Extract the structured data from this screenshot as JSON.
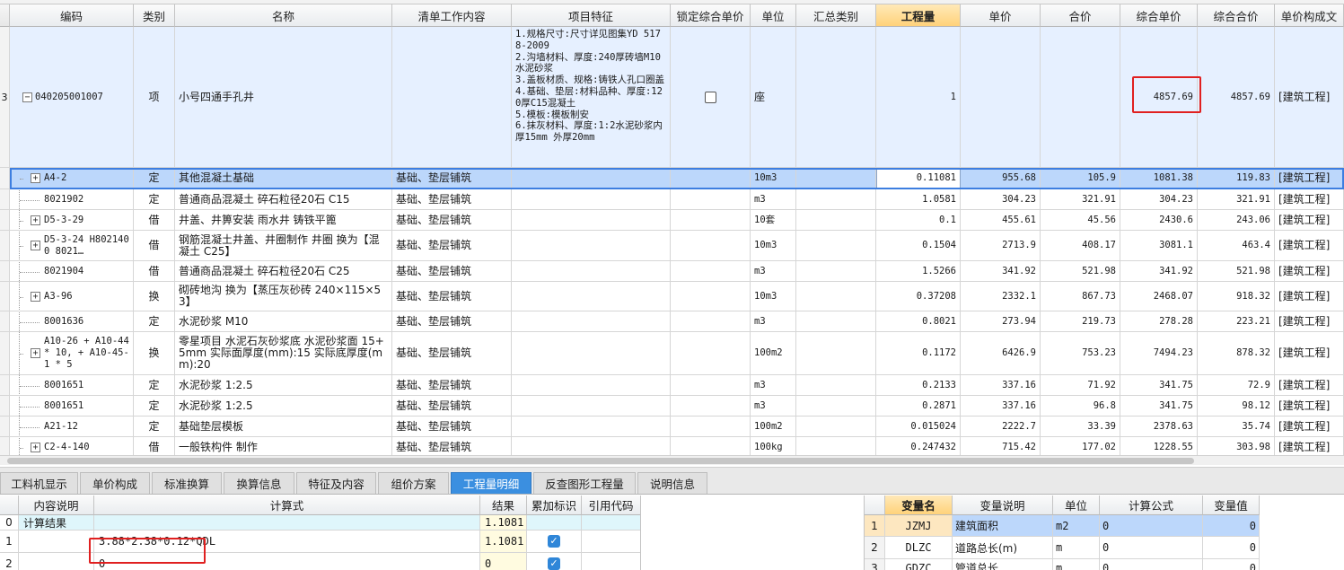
{
  "main_table": {
    "headers": [
      "编码",
      "类别",
      "名称",
      "清单工作内容",
      "项目特征",
      "锁定综合单价",
      "单位",
      "汇总类别",
      "工程量",
      "单价",
      "合价",
      "综合单价",
      "综合合价",
      "单价构成文"
    ],
    "parent": {
      "row_no": "3",
      "code": "040205001007",
      "category": "项",
      "name": "小号四通手孔井",
      "features": "1.规格尺寸:尺寸详见图集YD 5178-2009\n2.沟墙材料、厚度:240厚砖墙M10水泥砂浆\n3.盖板材质、规格:铸铁人孔口圈盖\n4.基础、垫层:材料品种、厚度:120厚C15混凝土\n5.模板:模板制安\n6.抹灰材料、厚度:1:2水泥砂浆内厚15mm 外厚20mm",
      "unit": "座",
      "quantity": "1",
      "comp_unit_price": "4857.69",
      "comp_total": "4857.69",
      "price_comp": "[建筑工程]"
    },
    "rows": [
      {
        "code": "A4-2",
        "expander": true,
        "category": "定",
        "name": "其他混凝土基础",
        "content": "基础、垫层铺筑",
        "unit": "10m3",
        "qty": "0.11081",
        "price": "955.68",
        "total": "105.9",
        "cup": "1081.38",
        "ctotal": "119.83",
        "comp": "[建筑工程]"
      },
      {
        "code": "8021902",
        "expander": false,
        "category": "定",
        "name": "普通商品混凝土 碎石粒径20石 C15",
        "content": "基础、垫层铺筑",
        "unit": "m3",
        "qty": "1.0581",
        "price": "304.23",
        "total": "321.91",
        "cup": "304.23",
        "ctotal": "321.91",
        "comp": "[建筑工程]"
      },
      {
        "code": "D5-3-29",
        "expander": true,
        "category": "借",
        "name": "井盖、井箅安装 雨水井 铸铁平篦",
        "content": "基础、垫层铺筑",
        "unit": "10套",
        "qty": "0.1",
        "price": "455.61",
        "total": "45.56",
        "cup": "2430.6",
        "ctotal": "243.06",
        "comp": "[建筑工程]"
      },
      {
        "code": "D5-3-24 H8021400 8021…",
        "expander": true,
        "category": "借",
        "name": "钢筋混凝土井盖、井圈制作 井圈  换为【混凝土 C25】",
        "content": "基础、垫层铺筑",
        "unit": "10m3",
        "qty": "0.1504",
        "price": "2713.9",
        "total": "408.17",
        "cup": "3081.1",
        "ctotal": "463.4",
        "comp": "[建筑工程]"
      },
      {
        "code": "8021904",
        "expander": false,
        "category": "借",
        "name": "普通商品混凝土 碎石粒径20石 C25",
        "content": "基础、垫层铺筑",
        "unit": "m3",
        "qty": "1.5266",
        "price": "341.92",
        "total": "521.98",
        "cup": "341.92",
        "ctotal": "521.98",
        "comp": "[建筑工程]"
      },
      {
        "code": "A3-96",
        "expander": true,
        "category": "换",
        "name": "砌砖地沟  换为【蒸压灰砂砖 240×115×53】",
        "content": "基础、垫层铺筑",
        "unit": "10m3",
        "qty": "0.37208",
        "price": "2332.1",
        "total": "867.73",
        "cup": "2468.07",
        "ctotal": "918.32",
        "comp": "[建筑工程]"
      },
      {
        "code": "8001636",
        "expander": false,
        "category": "定",
        "name": "水泥砂浆 M10",
        "content": "基础、垫层铺筑",
        "unit": "m3",
        "qty": "0.8021",
        "price": "273.94",
        "total": "219.73",
        "cup": "278.28",
        "ctotal": "223.21",
        "comp": "[建筑工程]"
      },
      {
        "code": "A10-26 + A10-44 * 10, + A10-45-1 * 5",
        "expander": true,
        "category": "换",
        "name": "零星项目 水泥石灰砂浆底 水泥砂浆面 15+5mm  实际面厚度(mm):15  实际底厚度(mm):20",
        "content": "基础、垫层铺筑",
        "unit": "100m2",
        "qty": "0.1172",
        "price": "6426.9",
        "total": "753.23",
        "cup": "7494.23",
        "ctotal": "878.32",
        "comp": "[建筑工程]"
      },
      {
        "code": "8001651",
        "expander": false,
        "category": "定",
        "name": "水泥砂浆 1:2.5",
        "content": "基础、垫层铺筑",
        "unit": "m3",
        "qty": "0.2133",
        "price": "337.16",
        "total": "71.92",
        "cup": "341.75",
        "ctotal": "72.9",
        "comp": "[建筑工程]"
      },
      {
        "code": "8001651",
        "expander": false,
        "category": "定",
        "name": "水泥砂浆 1:2.5",
        "content": "基础、垫层铺筑",
        "unit": "m3",
        "qty": "0.2871",
        "price": "337.16",
        "total": "96.8",
        "cup": "341.75",
        "ctotal": "98.12",
        "comp": "[建筑工程]"
      },
      {
        "code": "A21-12",
        "expander": false,
        "category": "定",
        "name": "基础垫层模板",
        "content": "基础、垫层铺筑",
        "unit": "100m2",
        "qty": "0.015024",
        "price": "2222.7",
        "total": "33.39",
        "cup": "2378.63",
        "ctotal": "35.74",
        "comp": "[建筑工程]"
      },
      {
        "code": "C2-4-140",
        "expander": true,
        "category": "借",
        "name": "一般铁构件 制作",
        "content": "基础、垫层铺筑",
        "unit": "100kg",
        "qty": "0.247432",
        "price": "715.42",
        "total": "177.02",
        "cup": "1228.55",
        "ctotal": "303.98",
        "comp": "[建筑工程]"
      }
    ]
  },
  "tabs": [
    {
      "label": "工料机显示",
      "active": false
    },
    {
      "label": "单价构成",
      "active": false
    },
    {
      "label": "标准换算",
      "active": false
    },
    {
      "label": "换算信息",
      "active": false
    },
    {
      "label": "特征及内容",
      "active": false
    },
    {
      "label": "组价方案",
      "active": false
    },
    {
      "label": "工程量明细",
      "active": true
    },
    {
      "label": "反查图形工程量",
      "active": false
    },
    {
      "label": "说明信息",
      "active": false
    }
  ],
  "quantity_detail": {
    "headers": [
      "内容说明",
      "计算式",
      "结果",
      "累加标识",
      "引用代码"
    ],
    "rows": [
      {
        "no": "0",
        "desc": "计算结果",
        "formula": "",
        "result": "1.1081",
        "checked": false
      },
      {
        "no": "1",
        "desc": "",
        "formula": "3.88*2.38*0.12*QDL",
        "result": "1.1081",
        "checked": true
      },
      {
        "no": "2",
        "desc": "",
        "formula": "0",
        "result": "0",
        "checked": true
      }
    ]
  },
  "variables": {
    "headers": [
      "变量名",
      "变量说明",
      "单位",
      "计算公式",
      "变量值"
    ],
    "rows": [
      {
        "no": "1",
        "name": "JZMJ",
        "desc": "建筑面积",
        "unit": "m2",
        "formula": "0",
        "value": "0"
      },
      {
        "no": "2",
        "name": "DLZC",
        "desc": "道路总长(m)",
        "unit": "m",
        "formula": "0",
        "value": "0"
      },
      {
        "no": "3",
        "name": "GDZC",
        "desc": "管道总长",
        "unit": "m",
        "formula": "0",
        "value": "0"
      }
    ]
  },
  "colors": {
    "accent": "#3b8fe0",
    "highlight_row": "#bcd7fb",
    "parent_row": "#e6f0ff",
    "annotation": "#e02020",
    "selected_header": "#ffd27a"
  }
}
